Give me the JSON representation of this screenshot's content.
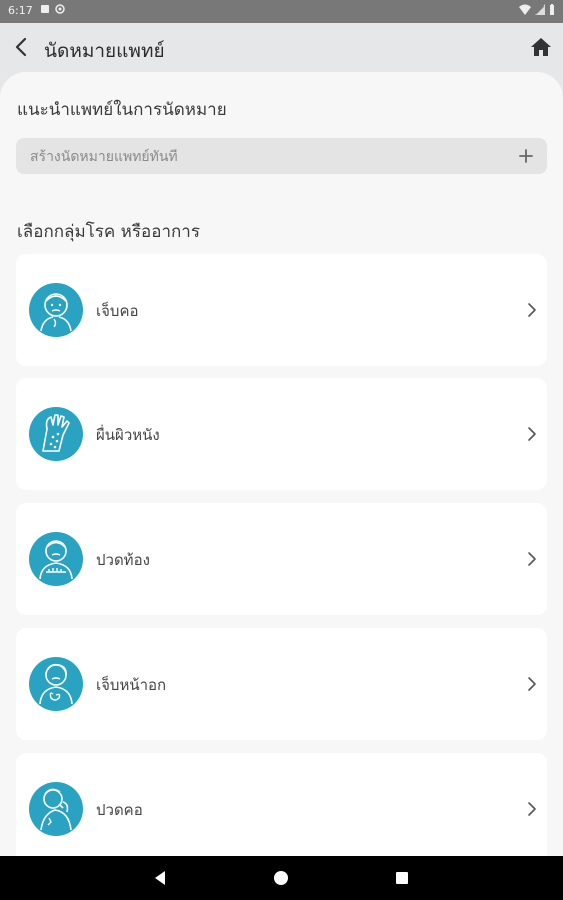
{
  "status_bar": {
    "time": "6:17"
  },
  "app_bar": {
    "title": "นัดหมายแพทย์"
  },
  "recommend": {
    "title": "แนะนำแพทย์ในการนัดหมาย",
    "input_placeholder": "สร้างนัดหมายแพทย์ทันที"
  },
  "groups": {
    "title": "เลือกกลุ่มโรค หรืออาการ",
    "items": [
      {
        "label": "เจ็บคอ",
        "icon": "sore-throat-icon"
      },
      {
        "label": "ผื่นผิวหนัง",
        "icon": "skin-rash-icon"
      },
      {
        "label": "ปวดท้อง",
        "icon": "stomach-ache-icon"
      },
      {
        "label": "เจ็บหน้าอก",
        "icon": "chest-pain-icon"
      },
      {
        "label": "ปวดคอ",
        "icon": "neck-pain-icon"
      }
    ]
  },
  "colors": {
    "accent": "#29a3c1",
    "background": "#f7f7f7",
    "card": "#ffffff",
    "appbar": "#e6e7e9"
  }
}
